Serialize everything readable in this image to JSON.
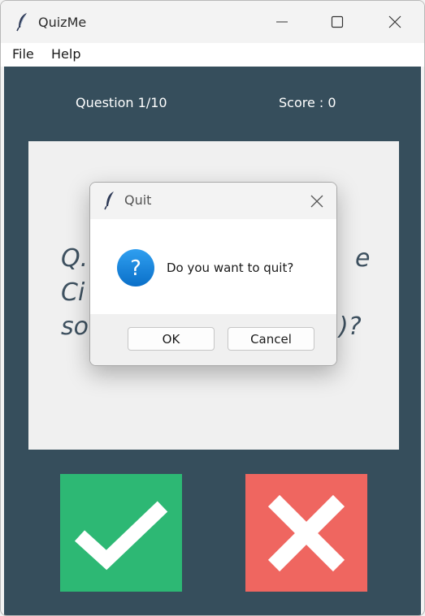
{
  "window": {
    "title": "QuizMe",
    "icons": {
      "app": "feather-icon",
      "minimize": "minimize-icon",
      "maximize": "maximize-icon",
      "close": "close-icon"
    }
  },
  "menu": {
    "items": [
      "File",
      "Help"
    ]
  },
  "header": {
    "question_counter": "Question 1/10",
    "score": "Score : 0"
  },
  "question": {
    "visible_fragments": [
      [
        "Q.",
        "e"
      ],
      [
        "Ci",
        ""
      ],
      [
        "so",
        ")?"
      ]
    ]
  },
  "answers": {
    "true_icon": "checkmark-icon",
    "false_icon": "cross-icon",
    "true_color": "#2db874",
    "false_color": "#ef6660"
  },
  "dialog": {
    "title": "Quit",
    "icon": "feather-icon",
    "message_icon": "question-icon",
    "message": "Do you want to quit?",
    "ok_label": "OK",
    "cancel_label": "Cancel"
  },
  "colors": {
    "background": "#364e5c",
    "card": "#f0f0f0",
    "question_text": "#3e5160"
  }
}
